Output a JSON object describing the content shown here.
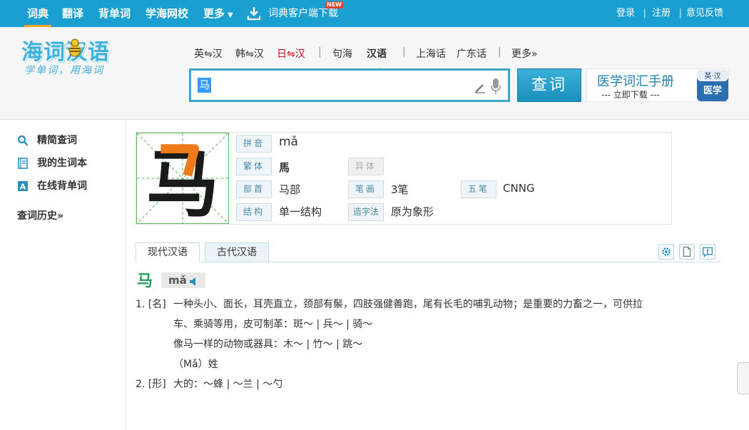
{
  "topnav": {
    "items": [
      {
        "label": "词典"
      },
      {
        "label": "翻译"
      },
      {
        "label": "背单词"
      },
      {
        "label": "学海网校"
      },
      {
        "label": "更多"
      }
    ],
    "more_caret": "▼",
    "download_label": "词典客户端下载",
    "new_badge": "NEW",
    "links": [
      "登录",
      "注册",
      "意见反馈"
    ],
    "separator": "|"
  },
  "logo": {
    "main": "海词汉语",
    "sub": "学单词，用海词"
  },
  "dict_tabs": [
    {
      "label": "英⇋汉"
    },
    {
      "label": "韩⇋汉"
    },
    {
      "label": "日⇋汉"
    },
    {
      "label": "句海"
    },
    {
      "label": "汉语"
    },
    {
      "label": "上海话"
    },
    {
      "label": "广东话"
    },
    {
      "label": "更多»"
    }
  ],
  "dict_sep": "|",
  "search": {
    "value": "马",
    "button_label": "查词"
  },
  "promo": {
    "title": "医学词汇手册",
    "subtitle": "--- 立即下载 ---",
    "book_line1": "英·汉",
    "book_line2": "医学"
  },
  "sidebar": {
    "items": [
      {
        "label": "精简查词",
        "icon": "search-icon"
      },
      {
        "label": "我的生词本",
        "icon": "notebook-icon"
      },
      {
        "label": "在线背单词",
        "icon": "flashcard-icon"
      }
    ],
    "history": "查词历史»"
  },
  "char_info": {
    "glyph": "马",
    "labels": {
      "pinyin": "拼音",
      "traditional": "繁体",
      "variant": "异体",
      "radical": "部首",
      "strokes": "笔画",
      "wubi": "五笔",
      "structure": "结构",
      "formation": "造字法"
    },
    "values": {
      "pinyin": "mǎ",
      "traditional": "馬",
      "radical": "马部",
      "strokes": "3笔",
      "wubi": "CNNG",
      "structure": "单一结构",
      "formation": "原为象形"
    }
  },
  "def_tabs": [
    {
      "label": "现代汉语"
    },
    {
      "label": "古代汉语"
    }
  ],
  "definition": {
    "head_char": "马",
    "head_pinyin": "mǎ",
    "senses": [
      {
        "num": "1. [名]",
        "lines": [
          "一种头小、面长，耳壳直立，颈部有鬃，四肢强健善跑，尾有长毛的哺乳动物；是重要的力畜之一，可供拉",
          "车、乘骑等用，皮可制革：斑～ | 兵～ | 骑～",
          "像马一样的动物或器具：木～ | 竹～ | 跳～",
          "（Mǎ）姓"
        ]
      },
      {
        "num": "2. [形]",
        "lines": [
          "大的：～蜂 | ～兰 | ～勺"
        ]
      }
    ]
  },
  "colors": {
    "nav_bg": "#1a9fd1",
    "accent": "#3aa6c8",
    "active_underline": "#f6a623",
    "head_green": "#2aa05a",
    "red": "#d0021b"
  }
}
